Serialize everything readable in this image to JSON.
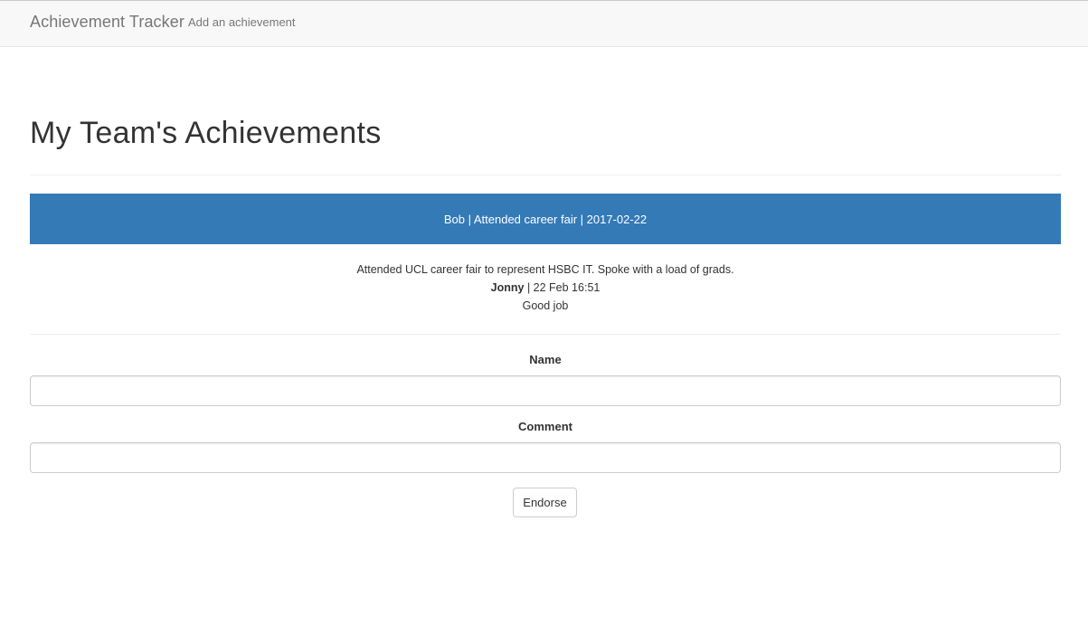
{
  "navbar": {
    "brand": "Achievement Tracker",
    "links": [
      {
        "label": "Add an achievement"
      }
    ]
  },
  "page": {
    "title": "My Team's Achievements"
  },
  "achievement": {
    "heading": "Bob | Attended career fair | 2017-02-22",
    "description": "Attended UCL career fair to represent HSBC IT. Spoke with a load of grads.",
    "endorsements": [
      {
        "name": "Jonny",
        "separator": " | ",
        "timestamp": "22 Feb 16:51",
        "comment": "Good job"
      }
    ]
  },
  "form": {
    "name_label": "Name",
    "name_value": "",
    "comment_label": "Comment",
    "comment_value": "",
    "submit_label": "Endorse"
  },
  "colors": {
    "primary": "#337ab7",
    "navbar_bg": "#f8f8f8",
    "text": "#333333",
    "muted": "#777777"
  }
}
